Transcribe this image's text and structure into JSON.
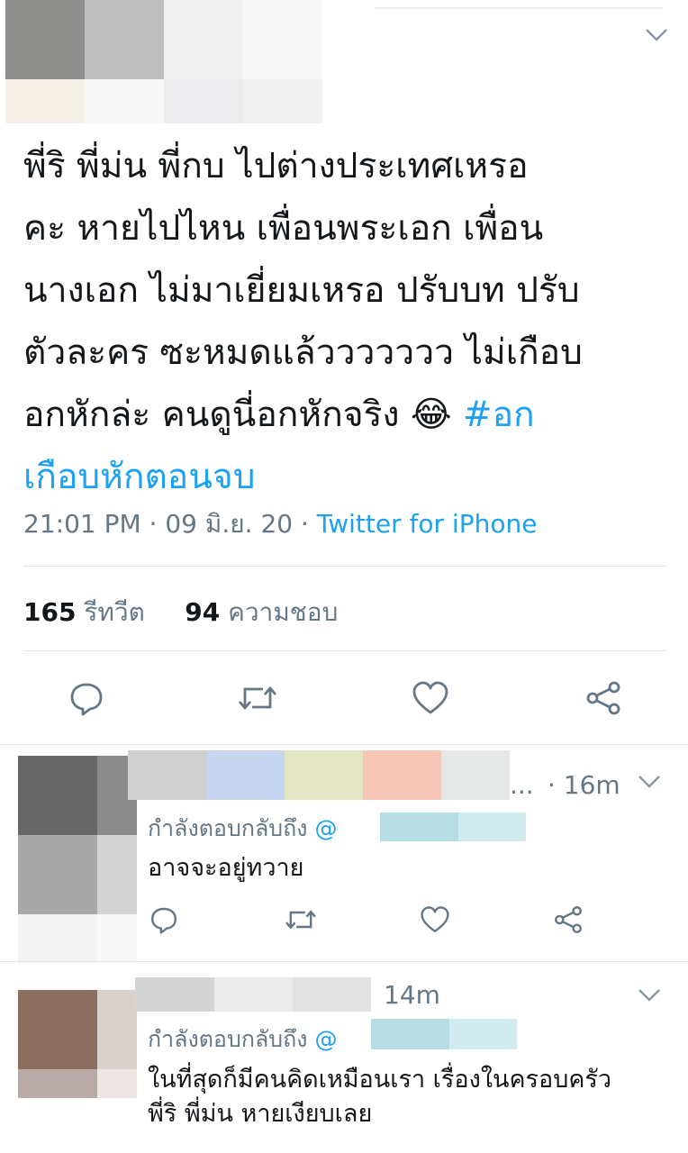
{
  "tweet": {
    "text_lines": [
      "พี่ริ พี่ม่น พี่กบ ไปต่างประเทศเหรอ",
      "คะ หายไปไหน เพื่อนพระเอก เพื่อน",
      "นางเอก ไม่มาเยี่ยมเหรอ ปรับบท ปรับ",
      "ตัวละคร ซะหมดแล้ววววววว ไม่เกือบ",
      "อกหักล่ะ คนดูนี่อกหักจริง "
    ],
    "emoji": "😂",
    "hashtag_part1": "#อก",
    "hashtag_part2": "เกือบหักตอนจบ",
    "time": "21:01 PM",
    "date": "09 มิ.ย. 20",
    "separator": " · ",
    "source": "Twitter for iPhone",
    "retweet_count": "165",
    "retweet_label": "รีทวีต",
    "like_count": "94",
    "like_label": "ความชอบ"
  },
  "actions": {
    "reply_icon": "reply-icon",
    "retweet_icon": "retweet-icon",
    "like_icon": "heart-icon",
    "share_icon": "share-icon"
  },
  "replies": [
    {
      "ellipsis": "...",
      "time": "· 16m",
      "replying_to_label": "กำลังตอบกลับถึง",
      "replying_to_handle": "@",
      "text": "อาจจะอยู่ทวาย"
    },
    {
      "time": "14m",
      "replying_to_label": "กำลังตอบกลับถึง",
      "replying_to_handle": "@",
      "text_lines": [
        "ในที่สุดก็มีคนคิดเหมือนเรา เรื่องในครอบครัว",
        "พี่ริ พี่ม่น หายเงียบเลย"
      ]
    }
  ],
  "colors": {
    "accent": "#1da1f2",
    "secondary_text": "#657786",
    "divider": "#e1e8ed"
  }
}
